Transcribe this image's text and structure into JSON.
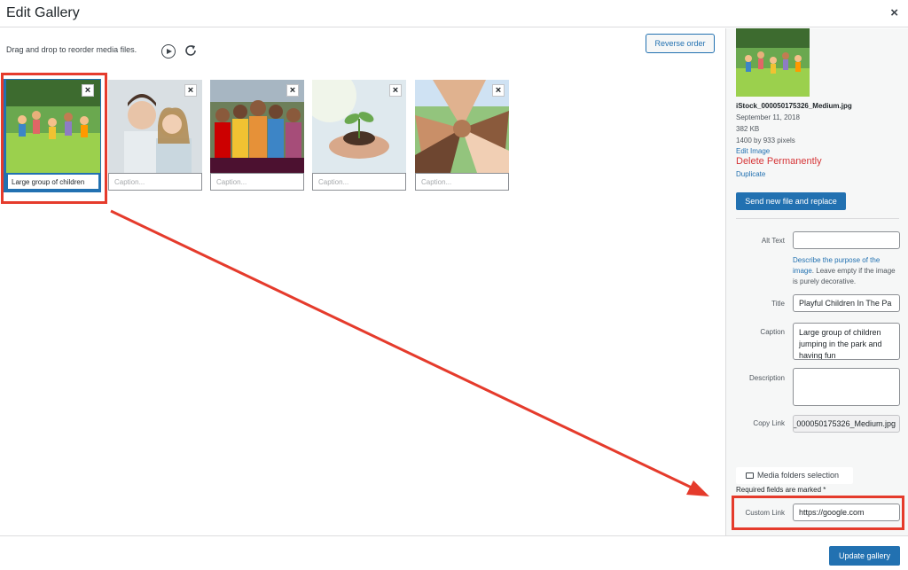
{
  "header": {
    "title": "Edit Gallery",
    "close_label": "×"
  },
  "toolbar": {
    "instructions": "Drag and drop to reorder media files.",
    "play_icon": "play-circle-icon",
    "refresh_icon": "refresh-icon",
    "reverse_label": "Reverse order"
  },
  "gallery": {
    "remove_label": "×",
    "caption_placeholder": "Caption...",
    "items": [
      {
        "caption": "Large group of children",
        "image": "children-jumping-park"
      },
      {
        "caption": "",
        "image": "couple-smiling"
      },
      {
        "caption": "",
        "image": "crowd-colorful"
      },
      {
        "caption": "",
        "image": "hands-plant-seedling"
      },
      {
        "caption": "",
        "image": "stacked-hands"
      }
    ]
  },
  "details": {
    "filename": "iStock_000050175326_Medium.jpg",
    "date": "September 11, 2018",
    "size": "382 KB",
    "dimensions": "1400 by 933 pixels",
    "edit_link": "Edit Image",
    "delete_link": "Delete Permanently",
    "duplicate_link": "Duplicate",
    "replace_button": "Send new file and replace"
  },
  "fields": {
    "alt_label": "Alt Text",
    "alt_value": "",
    "alt_help_link": "Describe the purpose of the image",
    "alt_help_rest": ". Leave empty if the image is purely decorative.",
    "title_label": "Title",
    "title_value": "Playful Children In The Pa",
    "caption_label": "Caption",
    "caption_value": "Large group of children jumping in the park and having fun",
    "description_label": "Description",
    "description_value": "",
    "copy_label": "Copy Link",
    "copy_value": "iStock_000050175326_Medium.jpg",
    "folders_button": "Media folders selection",
    "required_note": "Required fields are marked *",
    "custom_link_label": "Custom Link",
    "custom_link_value": "https://google.com"
  },
  "footer": {
    "update_button": "Update gallery"
  },
  "colors": {
    "accent": "#2271b1",
    "delete": "#d63638",
    "annotation": "#e53b2c"
  }
}
